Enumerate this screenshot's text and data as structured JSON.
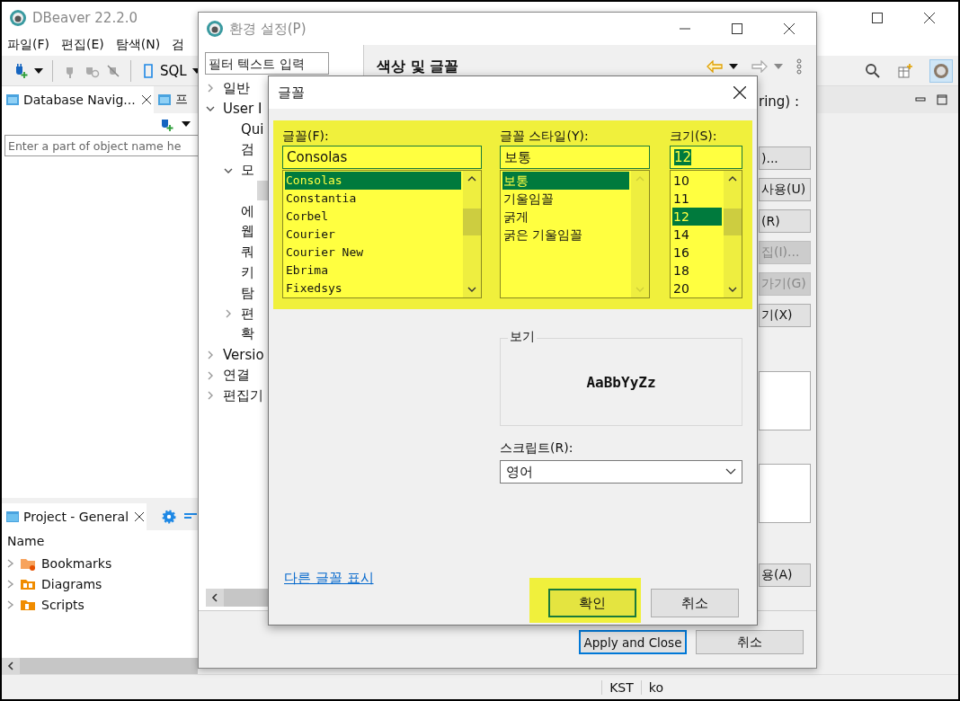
{
  "main_window": {
    "title": "DBeaver 22.2.0",
    "menu": [
      "파일(F)",
      "편집(E)",
      "탐색(N)",
      "검"
    ],
    "toolbar": {
      "sql_label": "SQL"
    },
    "navigator": {
      "tabs": [
        {
          "label": "Database Navig...",
          "selected": true
        },
        {
          "label": "프",
          "selected": false
        }
      ],
      "filter_placeholder": "Enter a part of object name he"
    },
    "project": {
      "tab": "Project - General",
      "column": "Name",
      "items": [
        {
          "label": "Bookmarks",
          "kind": "bookmarks"
        },
        {
          "label": "Diagrams",
          "kind": "diagrams"
        },
        {
          "label": "Scripts",
          "kind": "scripts"
        }
      ]
    },
    "status_bar": [
      "KST",
      "ko"
    ]
  },
  "preferences": {
    "title": "환경 설정(P)",
    "filter_placeholder": "필터 텍스트 입력",
    "tree": [
      {
        "label": "일반",
        "expanded": false,
        "selected": false
      },
      {
        "label": "User I",
        "expanded": true,
        "selected": false,
        "children": [
          {
            "label": "Qui",
            "selected": false
          },
          {
            "label": "검",
            "selected": false
          },
          {
            "label": "모",
            "expanded": true,
            "selected": false,
            "children": [
              {
                "selected": true
              }
            ]
          },
          {
            "label": "에",
            "selected": false
          },
          {
            "label": "웹",
            "selected": false
          },
          {
            "label": "쿼",
            "selected": false
          },
          {
            "label": "키",
            "selected": false
          },
          {
            "label": "탐",
            "selected": false
          },
          {
            "label": "편",
            "expanded": false,
            "selected": false
          },
          {
            "label": "확",
            "selected": false
          }
        ]
      },
      {
        "label": "Versio",
        "expanded": false,
        "selected": false
      },
      {
        "label": "연결",
        "expanded": false,
        "selected": false
      },
      {
        "label": "편집기",
        "expanded": false,
        "selected": false
      }
    ],
    "heading": "색상 및 글꼴",
    "fragment": "ring) :",
    "side_buttons": [
      {
        "label": ")...",
        "disabled": false
      },
      {
        "label": "사용(U)",
        "disabled": false
      },
      {
        "label": "(R)",
        "disabled": false
      },
      {
        "label": "집(I)...",
        "disabled": true
      },
      {
        "label": "가기(G)",
        "disabled": true
      },
      {
        "label": "기(X)",
        "disabled": false
      }
    ],
    "apply_fragment": "용(A)",
    "bottom_buttons": [
      {
        "label": "Apply and Close",
        "default": true
      },
      {
        "label": "취소",
        "default": false
      }
    ]
  },
  "font_dialog": {
    "title": "글꼴",
    "columns": [
      {
        "label": "글꼴(F):",
        "value": "Consolas",
        "value_selected": false,
        "scrollable": true,
        "options": [
          {
            "label": "Consolas",
            "selected": true
          },
          {
            "label": "Constantia",
            "selected": false
          },
          {
            "label": "Corbel",
            "selected": false
          },
          {
            "label": "Courier",
            "selected": false
          },
          {
            "label": "Courier New",
            "selected": false
          },
          {
            "label": "Ebrima",
            "selected": false
          },
          {
            "label": "Fixedsys",
            "selected": false
          }
        ]
      },
      {
        "label": "글꼴 스타일(Y):",
        "value": "보통",
        "value_selected": false,
        "scrollable": false,
        "options": [
          {
            "label": "보통",
            "selected": true
          },
          {
            "label": "기울임꼴",
            "selected": false
          },
          {
            "label": "굵게",
            "selected": false
          },
          {
            "label": "굵은 기울임꼴",
            "selected": false
          }
        ]
      },
      {
        "label": "크기(S):",
        "value": "12",
        "value_selected": true,
        "scrollable": true,
        "options": [
          {
            "label": "10",
            "selected": false
          },
          {
            "label": "11",
            "selected": false
          },
          {
            "label": "12",
            "selected": true
          },
          {
            "label": "14",
            "selected": false
          },
          {
            "label": "16",
            "selected": false
          },
          {
            "label": "18",
            "selected": false
          },
          {
            "label": "20",
            "selected": false
          }
        ]
      }
    ],
    "preview": {
      "label": "보기",
      "sample": "AaBbYyZz"
    },
    "script": {
      "label": "스크립트(R):",
      "value": "영어"
    },
    "more_fonts_link": "다른 글꼴 표시",
    "buttons": [
      {
        "label": "확인",
        "default": true
      },
      {
        "label": "취소",
        "default": false
      }
    ]
  }
}
